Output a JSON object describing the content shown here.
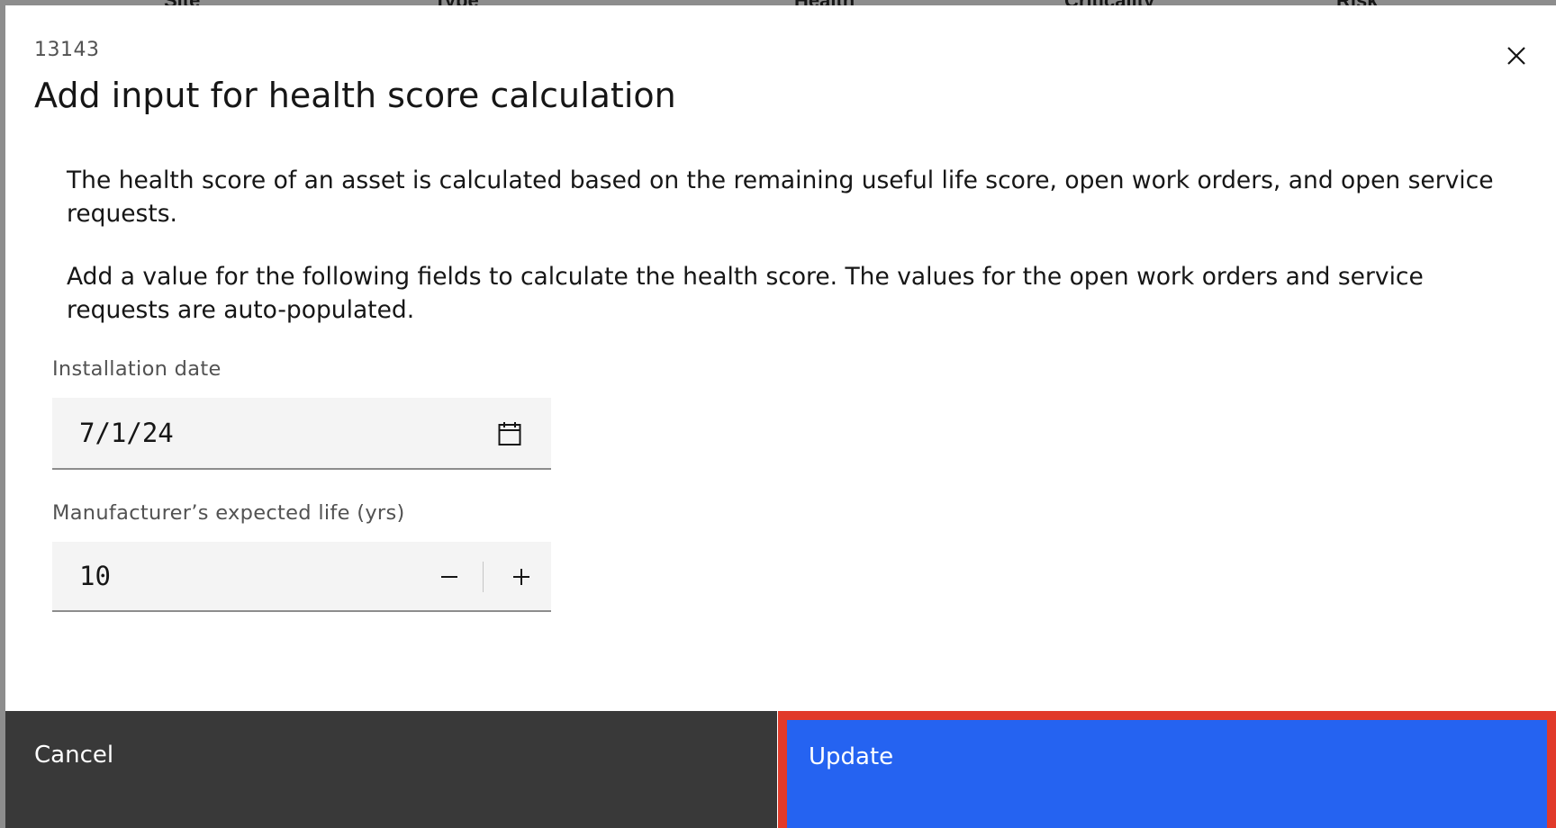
{
  "background": {
    "columns": [
      "Site",
      "Type",
      "Health",
      "Criticality",
      "Risk"
    ]
  },
  "modal": {
    "label": "13143",
    "title": "Add input for health score calculation",
    "description_1": "The health score of an asset is calculated based on the remaining useful life score, open work orders, and open service requests.",
    "description_2": "Add a value for the following fields to calculate the health score. The values for the open work orders and service requests are auto-populated.",
    "installation_date": {
      "label": "Installation date",
      "value": "7/1/24",
      "icon": "calendar-icon"
    },
    "expected_life": {
      "label": "Manufacturer’s expected life (yrs)",
      "value": "10",
      "decrement_icon": "minus-icon",
      "increment_icon": "plus-icon"
    },
    "close_icon": "close-icon"
  },
  "footer": {
    "cancel_label": "Cancel",
    "update_label": "Update"
  },
  "colors": {
    "primary": "#2563f1",
    "secondary": "#393939",
    "highlight": "#e13a2a"
  }
}
